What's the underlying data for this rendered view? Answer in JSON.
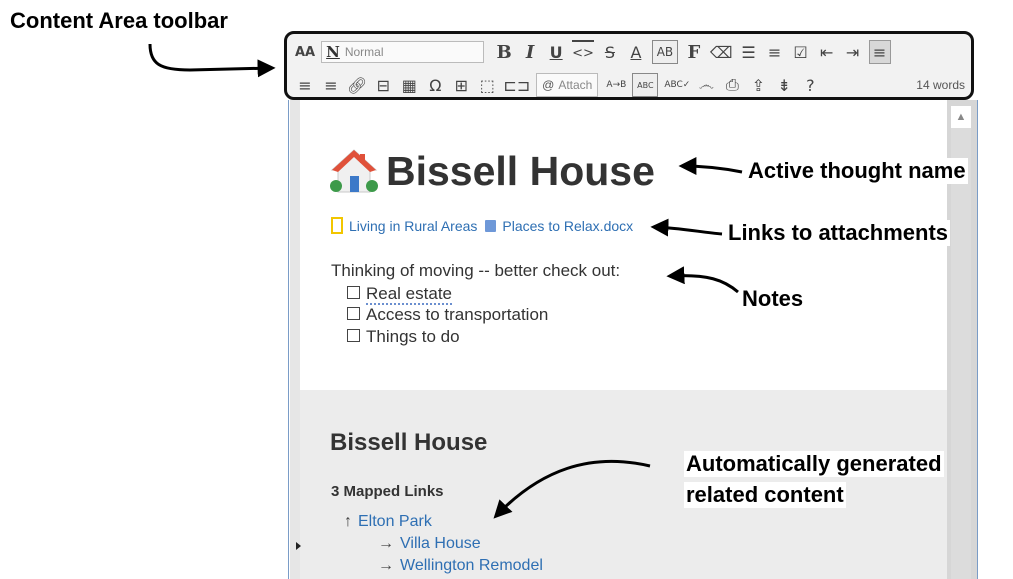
{
  "callouts": {
    "toolbar": "Content Area toolbar",
    "active_thought": "Active thought name",
    "attachments": "Links to attachments",
    "notes": "Notes",
    "related_line1": "Automatically  generated",
    "related_line2": "related content"
  },
  "toolbar": {
    "font_size_label": "AA",
    "style_value": "Normal",
    "style_icon": "N",
    "bold": "B",
    "italic": "I",
    "underline": "U",
    "format": "F",
    "attach_label": "Attach",
    "word_count": "14 words",
    "icons": [
      "font-size-icon",
      "bold-icon",
      "italic-icon",
      "underline-icon",
      "code-icon",
      "strikethrough-icon",
      "font-color-icon",
      "highlight-icon",
      "format-icon",
      "eraser-icon",
      "bullet-list-icon",
      "numbered-list-icon",
      "checkbox-icon",
      "outdent-icon",
      "indent-icon",
      "align-left-icon",
      "align-center-icon",
      "align-right-icon",
      "link-icon",
      "horizontal-rule-icon",
      "calendar-icon",
      "omega-icon",
      "table-icon",
      "frame-icon",
      "book-icon",
      "attach-icon",
      "find-replace-icon",
      "spellcheck-abc-icon",
      "spellcheck-icon",
      "mustache-icon",
      "print-icon",
      "export-icon",
      "collapse-icon",
      "help-icon"
    ]
  },
  "thought": {
    "name": "Bissell House",
    "attachments": [
      {
        "label": "Living in Rural Areas",
        "icon": "folder-note-icon"
      },
      {
        "label": "Places to Relax.docx",
        "icon": "document-icon"
      }
    ]
  },
  "notes": {
    "intro": "Thinking of moving -- better check out:",
    "items": [
      "Real estate",
      "Access to transportation",
      "Things to do"
    ]
  },
  "related": {
    "title": "Bissell House",
    "mapped_links_label": "3 Mapped Links",
    "links": [
      {
        "prefix": "↑",
        "label": "Elton Park"
      },
      {
        "prefix": "→",
        "label": "Villa House"
      },
      {
        "prefix": "→",
        "label": "Wellington Remodel"
      }
    ]
  },
  "colors": {
    "link": "#2e6fb3",
    "window_border": "#7a9cc7",
    "related_bg": "#ececec"
  }
}
